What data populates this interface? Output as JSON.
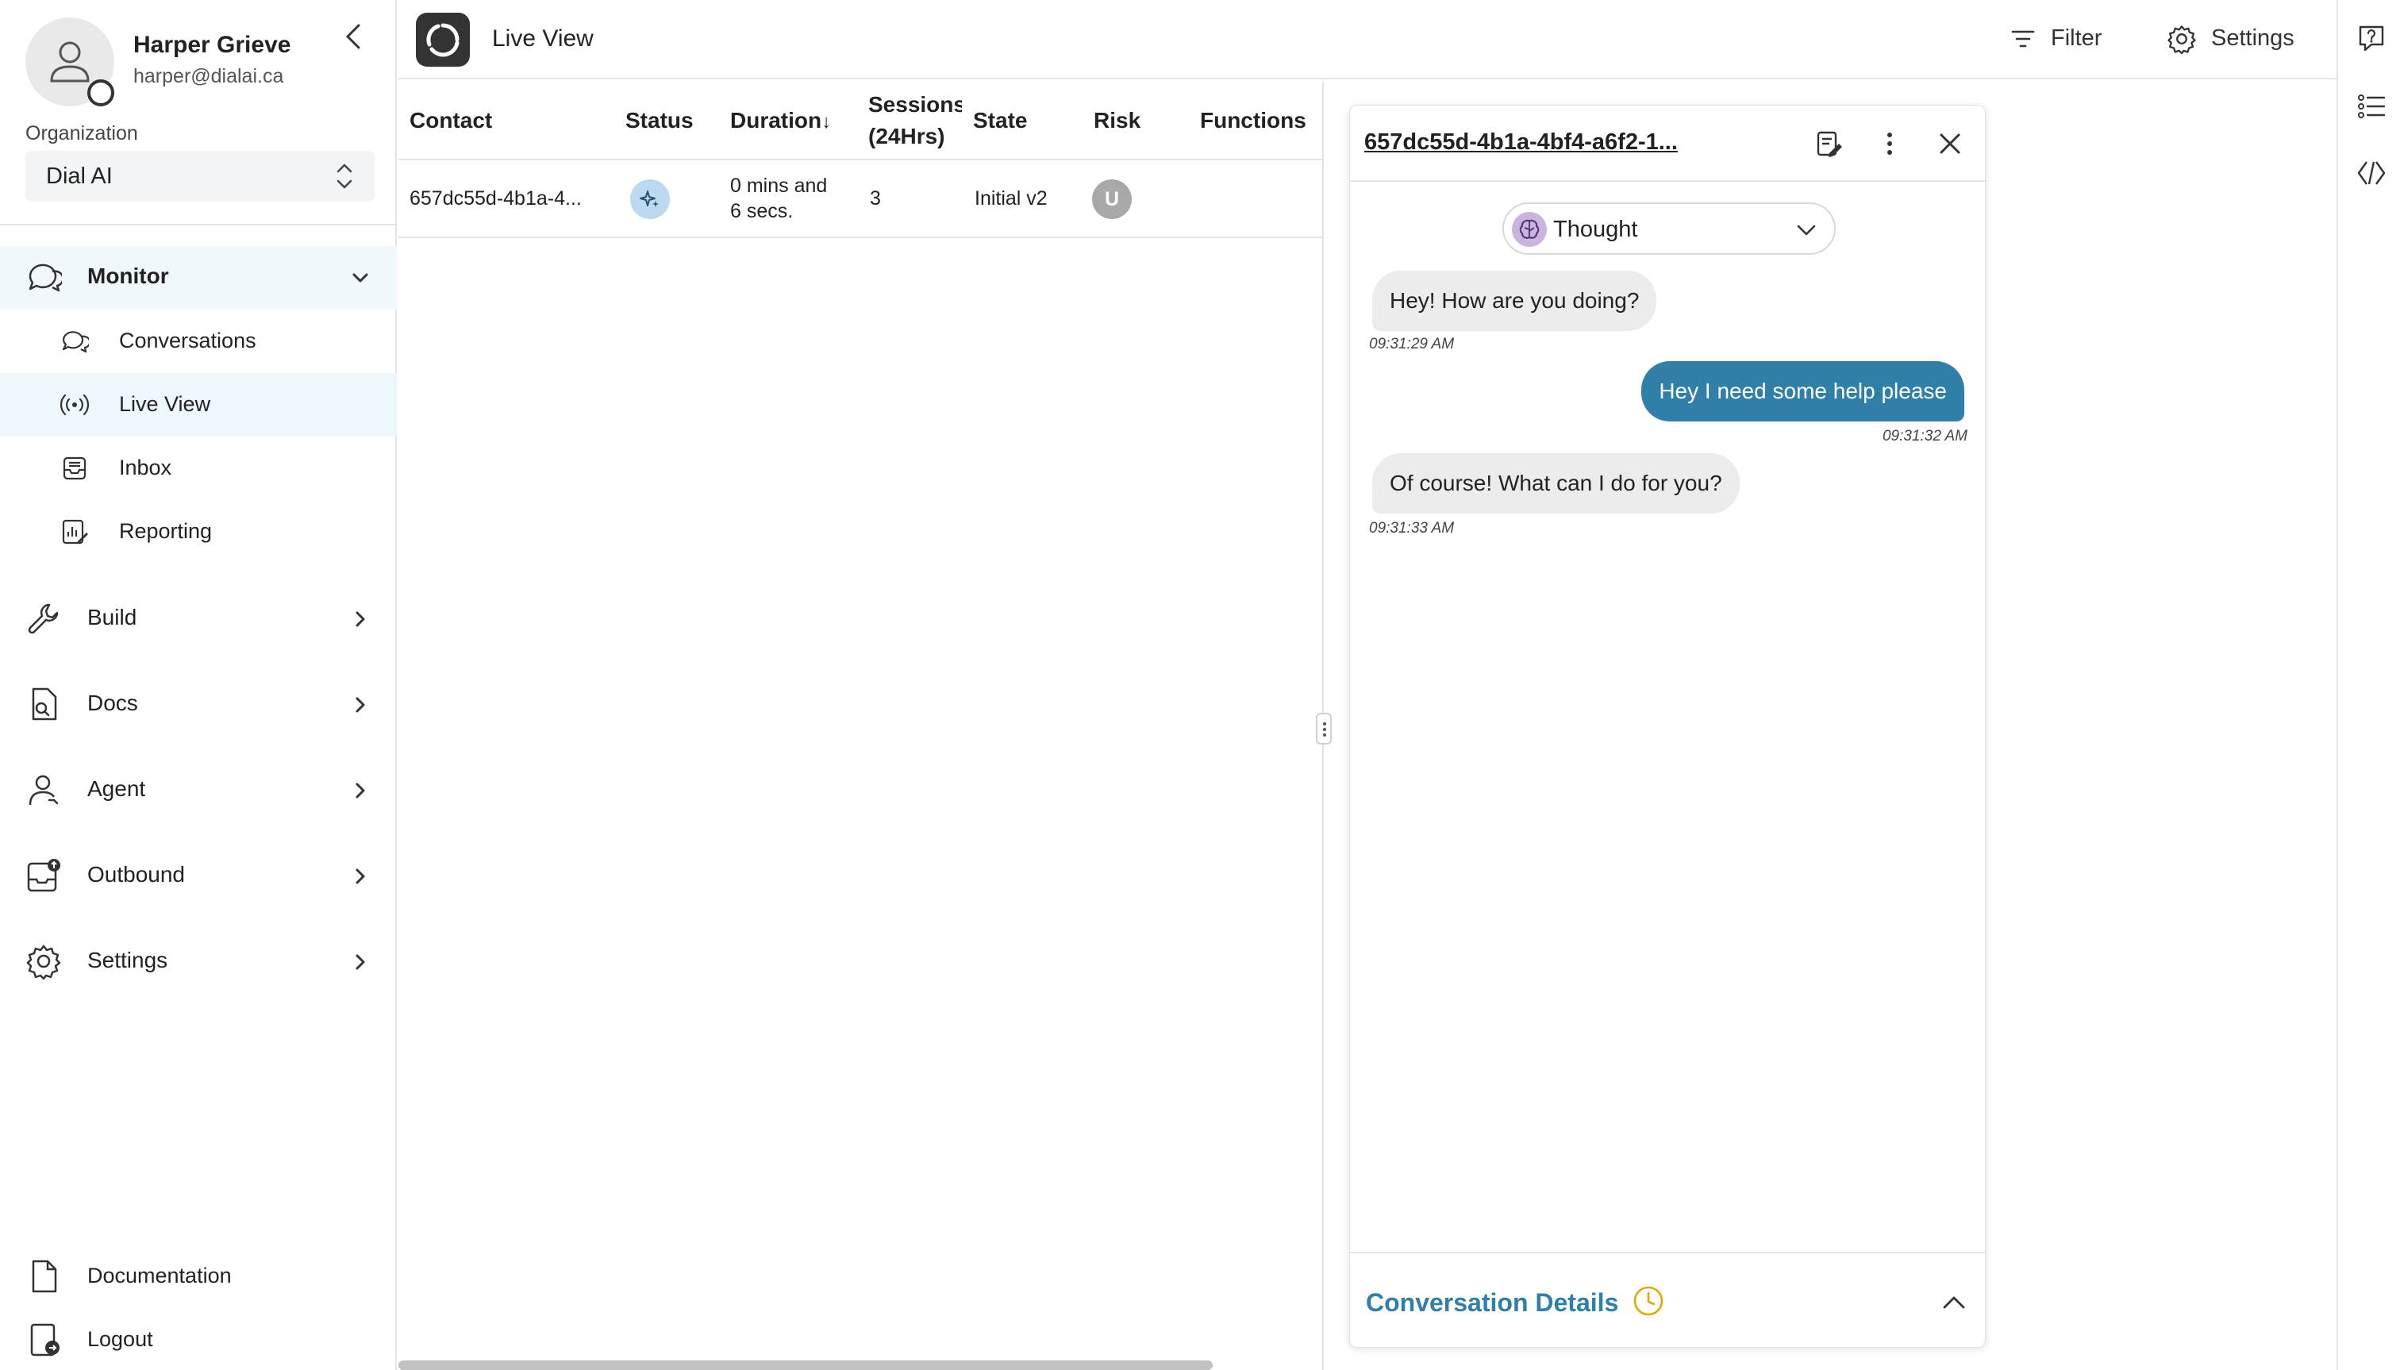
{
  "user": {
    "name": "Harper Grieve",
    "email": "harper@dialai.ca"
  },
  "organization": {
    "label": "Organization",
    "value": "Dial AI"
  },
  "nav": {
    "monitor": "Monitor",
    "monitor_items": [
      "Conversations",
      "Live View",
      "Inbox",
      "Reporting"
    ],
    "build": "Build",
    "docs": "Docs",
    "agent": "Agent",
    "outbound": "Outbound",
    "settings": "Settings",
    "documentation": "Documentation",
    "logout": "Logout"
  },
  "header": {
    "title": "Live View",
    "filter_label": "Filter",
    "settings_label": "Settings"
  },
  "table": {
    "columns": [
      "Contact",
      "Status",
      "Duration",
      "Sessions",
      "(24Hrs)",
      "State",
      "Risk",
      "Functions"
    ],
    "sort_indicator": "↓",
    "rows": [
      {
        "contact": "657dc55d-4b1a-4...",
        "duration_line1": "0 mins and",
        "duration_line2": "6 secs.",
        "sessions": "3",
        "state": "Initial v2",
        "risk": "U",
        "functions": ""
      }
    ]
  },
  "chat": {
    "conversation_id": "657dc55d-4b1a-4bf4-a6f2-1...",
    "view_mode": "Thought",
    "messages": [
      {
        "from": "agent",
        "text": "Hey! How are you doing?",
        "time": "09:31:29 AM"
      },
      {
        "from": "user",
        "text": "Hey I need some help please",
        "time": "09:31:32 AM"
      },
      {
        "from": "agent",
        "text": "Of course! What can I do for you?",
        "time": "09:31:33 AM"
      }
    ],
    "details_label": "Conversation Details"
  },
  "colors": {
    "accent": "#2f7fa8",
    "active_nav_bg": "#eef7fc",
    "status_badge": "#bcd9ef",
    "clock": "#e0a800"
  }
}
